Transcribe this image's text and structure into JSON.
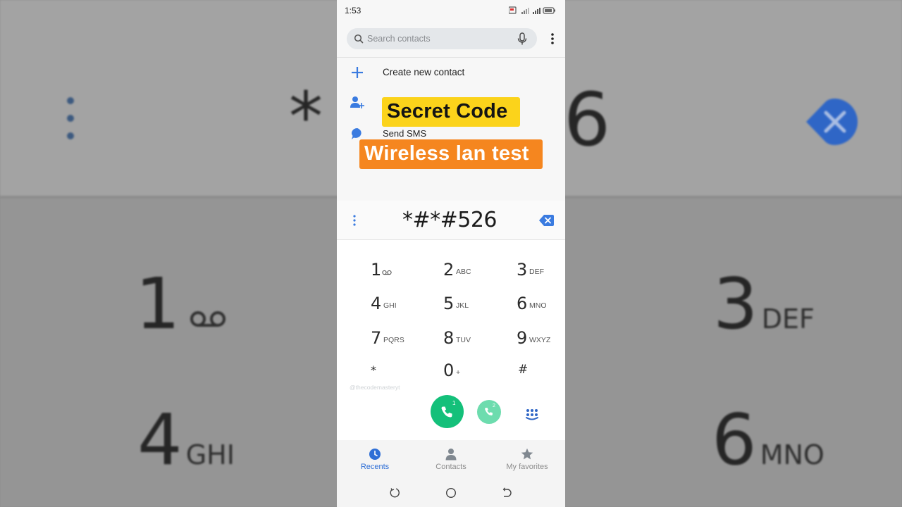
{
  "background": {
    "big_text": "*",
    "big_digit_right": "6",
    "keys": [
      {
        "digit": "1",
        "letters": ""
      },
      {
        "digit": "3",
        "letters": "DEF"
      },
      {
        "digit": "4",
        "letters": "GHI"
      },
      {
        "digit": "6",
        "letters": "MNO"
      }
    ]
  },
  "status_bar": {
    "time": "1:53"
  },
  "search": {
    "placeholder": "Search contacts"
  },
  "actions": {
    "create_contact": "Create new contact",
    "send_sms": "Send SMS"
  },
  "overlay": {
    "title": "Secret Code",
    "subtitle": "Wireless lan test",
    "title_color": "#fbd31b",
    "subtitle_color": "#f5861f"
  },
  "dialer": {
    "entered_number": "*#*#526",
    "keys": [
      {
        "digit": "1",
        "letters": ""
      },
      {
        "digit": "2",
        "letters": "ABC"
      },
      {
        "digit": "3",
        "letters": "DEF"
      },
      {
        "digit": "4",
        "letters": "GHI"
      },
      {
        "digit": "5",
        "letters": "JKL"
      },
      {
        "digit": "6",
        "letters": "MNO"
      },
      {
        "digit": "7",
        "letters": "PQRS"
      },
      {
        "digit": "8",
        "letters": "TUV"
      },
      {
        "digit": "9",
        "letters": "WXYZ"
      },
      {
        "digit": "*",
        "letters": ""
      },
      {
        "digit": "0",
        "letters": "+"
      },
      {
        "digit": "#",
        "letters": ""
      }
    ],
    "watermark": "@thecodemasteryt",
    "sim1": "1",
    "sim2": "2",
    "call_color": "#14c07a"
  },
  "bottom_nav": {
    "recents": "Recents",
    "contacts": "Contacts",
    "favorites": "My favorites",
    "active_color": "#2f6fd6"
  }
}
